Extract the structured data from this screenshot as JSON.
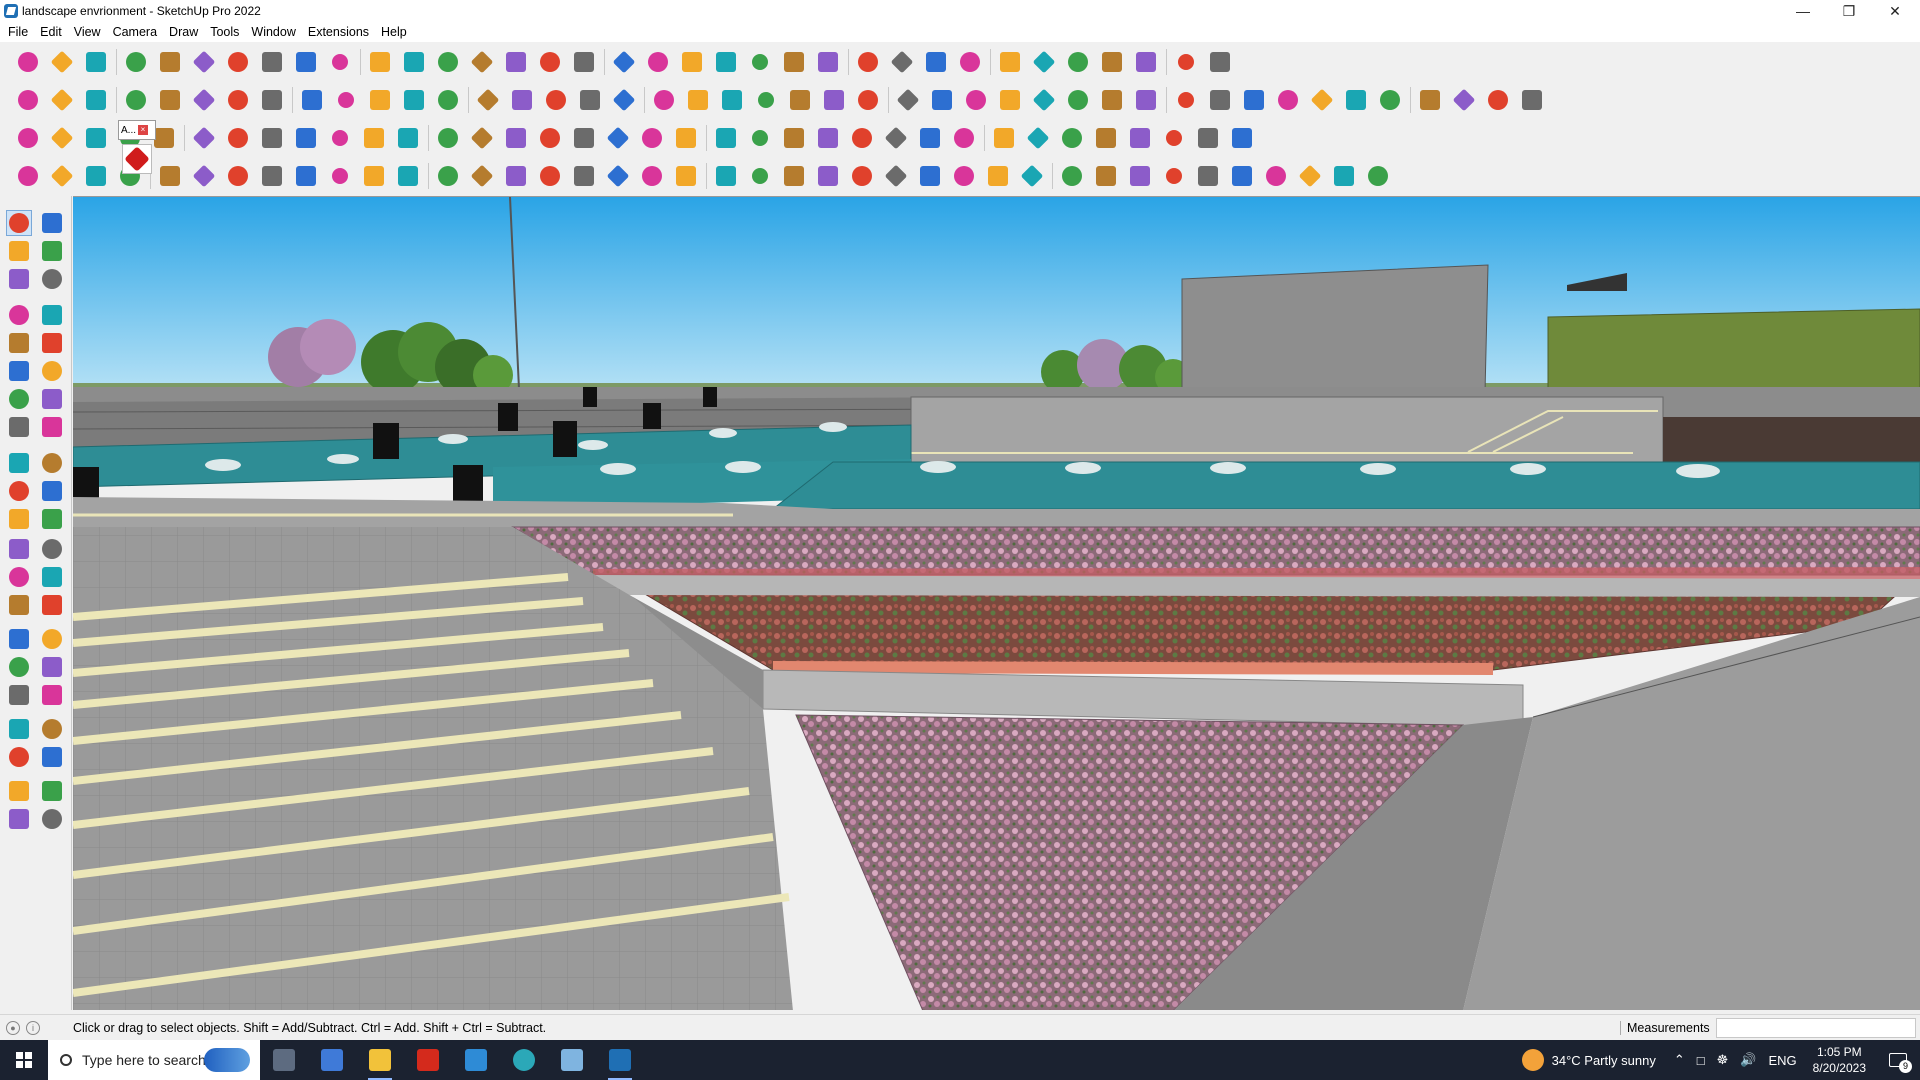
{
  "window": {
    "title": "landscape envrionment - SketchUp Pro 2022",
    "controls": [
      "minimize",
      "restore",
      "close"
    ]
  },
  "menu": [
    "File",
    "Edit",
    "View",
    "Camera",
    "Draw",
    "Tools",
    "Window",
    "Extensions",
    "Help"
  ],
  "toolbar_tooltip": "A...",
  "status": {
    "hint": "Click or drag to select objects. Shift = Add/Subtract. Ctrl = Add. Shift + Ctrl = Subtract.",
    "measurements_label": "Measurements",
    "measurements_value": ""
  },
  "taskbar": {
    "search_placeholder": "Type here to search",
    "weather": "34°C  Partly sunny",
    "language": "ENG",
    "time": "1:05 PM",
    "date": "8/20/2023",
    "notification_count": "9",
    "apps": [
      "task-view",
      "calculator",
      "file-explorer",
      "acrobat",
      "sketchup-layout",
      "edge",
      "notepad",
      "sketchup"
    ]
  },
  "colors": {
    "sky_top": "#2aa4e6",
    "sky_bottom": "#b9e3f6",
    "paving": "#9c9c9c",
    "water": "#2e8d95",
    "flowers_pink": "#b98aa0",
    "flowers_red": "#9b5a50",
    "taskbar": "#1b2230"
  }
}
